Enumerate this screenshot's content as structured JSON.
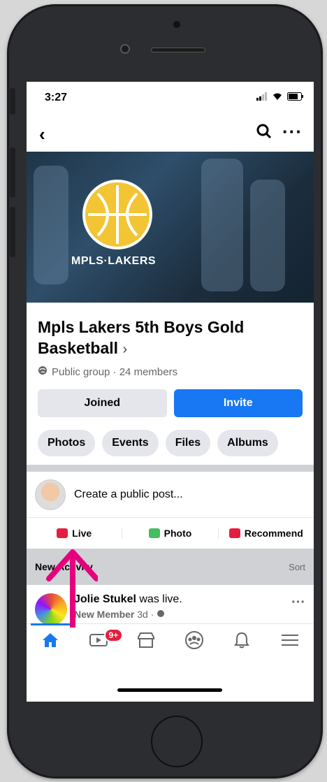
{
  "status_bar": {
    "time": "3:27"
  },
  "header": {
    "back_icon": "chevron-left-icon",
    "search_icon": "search-icon",
    "more_icon": "more-icon"
  },
  "cover": {
    "logo_text": "MPLS·LAKERS"
  },
  "group": {
    "title": "Mpls Lakers 5th Boys Gold Basketball",
    "chevron": "›",
    "meta": "Public group · 24 members"
  },
  "buttons": {
    "joined": "Joined",
    "invite": "Invite"
  },
  "chips": [
    "Photos",
    "Events",
    "Files",
    "Albums"
  ],
  "composer": {
    "placeholder": "Create a public post..."
  },
  "post_actions": {
    "live": "Live",
    "photo": "Photo",
    "recommend": "Recommend"
  },
  "activity": {
    "title": "New Activity",
    "sort": "Sort"
  },
  "feed": {
    "name": "Jolie Stukel",
    "action": "was live.",
    "badge": "New Member",
    "time": "3d ·"
  },
  "tabbar": {
    "watch_badge": "9+"
  },
  "colors": {
    "accent": "#1877f2",
    "live_red": "#e41e3f",
    "photo_green": "#45bd62",
    "annotation_pink": "#e5007e"
  }
}
